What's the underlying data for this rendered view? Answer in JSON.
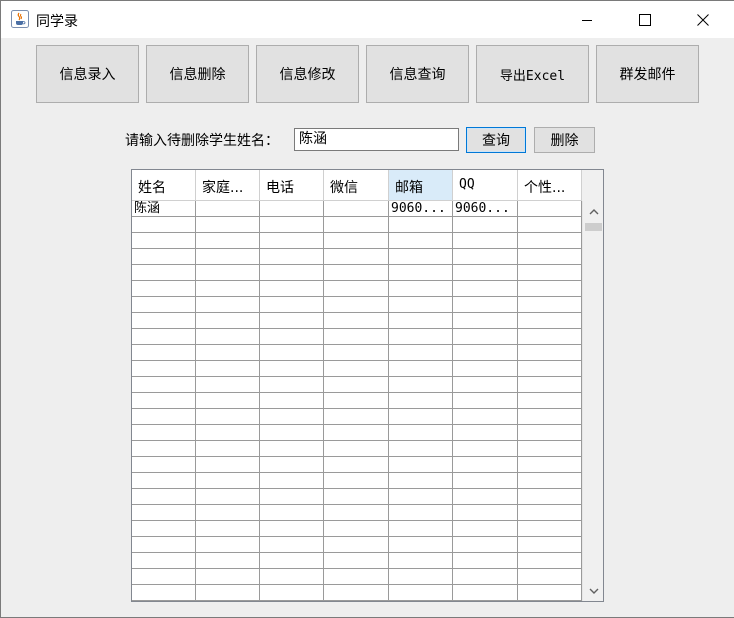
{
  "window": {
    "title": "同学录",
    "icon": "java-coffee-icon",
    "controls": [
      "minimize-icon",
      "maximize-icon",
      "close-icon"
    ]
  },
  "toolbar": {
    "buttons": [
      {
        "label": "信息录入"
      },
      {
        "label": "信息删除"
      },
      {
        "label": "信息修改"
      },
      {
        "label": "信息查询"
      },
      {
        "label": "导出Excel"
      },
      {
        "label": "群发邮件"
      }
    ]
  },
  "search": {
    "label": "请输入待删除学生姓名：",
    "value": "陈涵",
    "query_button": "查询",
    "delete_button": "删除"
  },
  "table": {
    "columns": [
      "姓名",
      "家庭...",
      "电话",
      "微信",
      "邮箱",
      "QQ",
      "个性..."
    ],
    "selected_column": "邮箱",
    "rows": [
      [
        "陈涵",
        "",
        "",
        "",
        "9060...",
        "9060...",
        ""
      ]
    ]
  },
  "colors": {
    "button_face": "#e1e1e1",
    "selected_header": "#d9ebf9",
    "focus_border": "#0078d7"
  }
}
